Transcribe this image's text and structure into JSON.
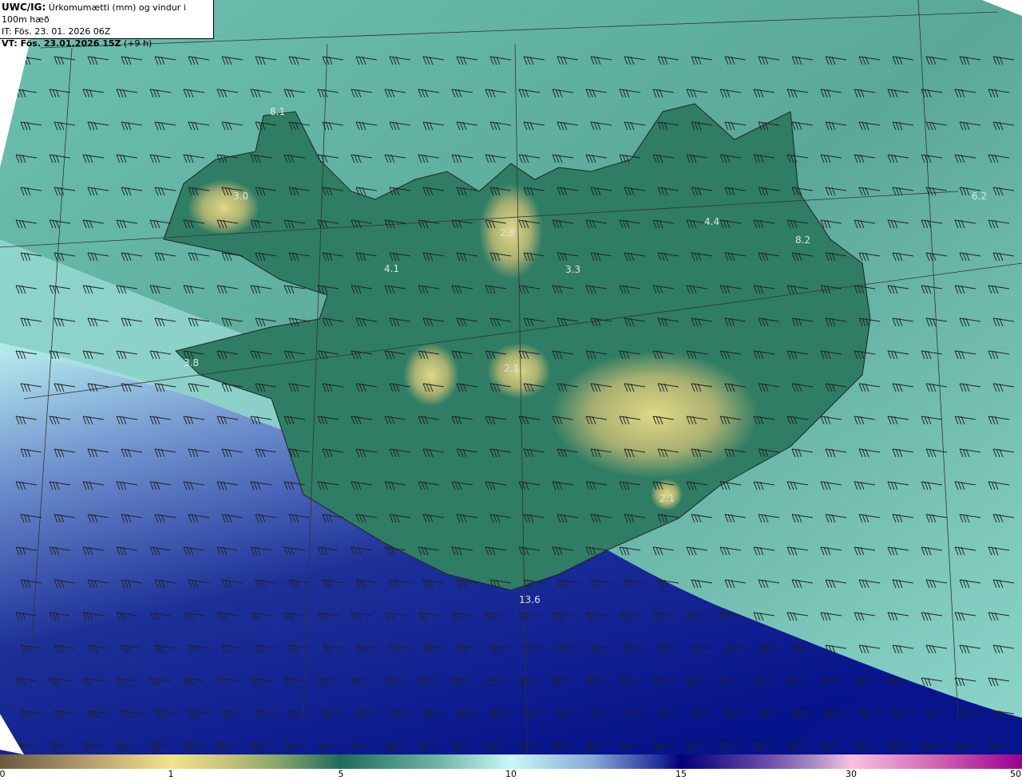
{
  "header": {
    "model_label": "UWC/IG:",
    "title": "Úrkomumætti (mm) og vindur i 100m hæð",
    "initial_time": "IT: Fös. 23. 01. 2026 06Z",
    "valid_label": "VT: Fös. 23.01.2026 15Z",
    "lead_time": "(+9 h)"
  },
  "map": {
    "region": "Iceland",
    "field": "precipitation",
    "overlay": "wind barbs",
    "value_labels": [
      "8.1",
      "3.0",
      "4.1",
      "2.8",
      "3.3",
      "4.4",
      "8.2",
      "6.2",
      "3.8",
      "2.1",
      "2.1",
      "13.6"
    ]
  },
  "colorbar": {
    "ticks": [
      "0",
      "1",
      "5",
      "10",
      "15",
      "30",
      "50"
    ],
    "colors": [
      "#6b5a3f",
      "#f2e38a",
      "#1f6d59",
      "#c8f8f6",
      "#000078",
      "#f8c0e0",
      "#980090"
    ]
  }
}
